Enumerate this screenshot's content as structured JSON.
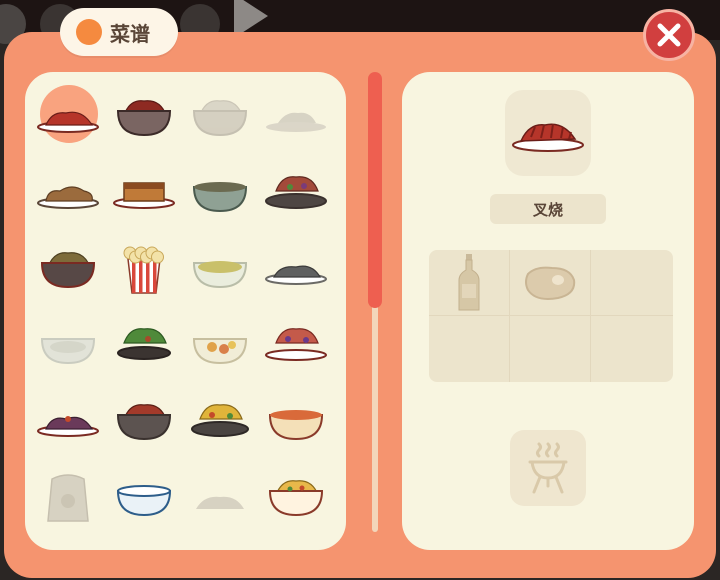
{
  "title": "菜谱",
  "colors": {
    "frame": "#f5946f",
    "panel": "#f8f5e0",
    "accent_orange": "#f58a3f",
    "close_red": "#d13f3f",
    "scroll_thumb": "#ee5f50",
    "selected_highlight": "#f9a37f"
  },
  "close_button": {
    "icon": "close-x-icon"
  },
  "recipes": [
    {
      "icon": "char-siu-plate-icon",
      "unlocked": true,
      "selected": true
    },
    {
      "icon": "meat-bowl-icon",
      "unlocked": true
    },
    {
      "icon": "rice-bowl-icon",
      "unlocked": false
    },
    {
      "icon": "flat-plate-icon",
      "unlocked": false
    },
    {
      "icon": "fried-chicken-plate-icon",
      "unlocked": true
    },
    {
      "icon": "cake-plate-icon",
      "unlocked": true
    },
    {
      "icon": "stew-bowl-icon",
      "unlocked": true
    },
    {
      "icon": "stir-fry-plate-icon",
      "unlocked": true
    },
    {
      "icon": "noodle-bowl-icon",
      "unlocked": true
    },
    {
      "icon": "popcorn-bucket-icon",
      "unlocked": true
    },
    {
      "icon": "salad-glass-bowl-icon",
      "unlocked": true
    },
    {
      "icon": "seafood-plate-icon",
      "unlocked": true
    },
    {
      "icon": "glass-bowl-icon",
      "unlocked": false
    },
    {
      "icon": "veggie-plate-icon",
      "unlocked": true
    },
    {
      "icon": "fruit-glass-bowl-icon",
      "unlocked": true
    },
    {
      "icon": "berry-plate-icon",
      "unlocked": true
    },
    {
      "icon": "grilled-plate-icon",
      "unlocked": true
    },
    {
      "icon": "beef-bowl-icon",
      "unlocked": true
    },
    {
      "icon": "curry-plate-icon",
      "unlocked": true
    },
    {
      "icon": "soup-bowl-icon",
      "unlocked": true
    },
    {
      "icon": "flour-sack-icon",
      "unlocked": false
    },
    {
      "icon": "blue-bowl-icon",
      "unlocked": true
    },
    {
      "icon": "rice-pile-icon",
      "unlocked": false
    },
    {
      "icon": "fried-rice-bowl-icon",
      "unlocked": true
    }
  ],
  "detail": {
    "dish_icon": "char-siu-plate-icon",
    "dish_name": "叉烧",
    "ingredients": [
      {
        "icon": "sauce-bottle-icon"
      },
      {
        "icon": "steak-icon"
      },
      {
        "icon": ""
      },
      {
        "icon": ""
      },
      {
        "icon": ""
      },
      {
        "icon": ""
      }
    ],
    "cooking_method": {
      "icon": "grill-icon"
    }
  }
}
